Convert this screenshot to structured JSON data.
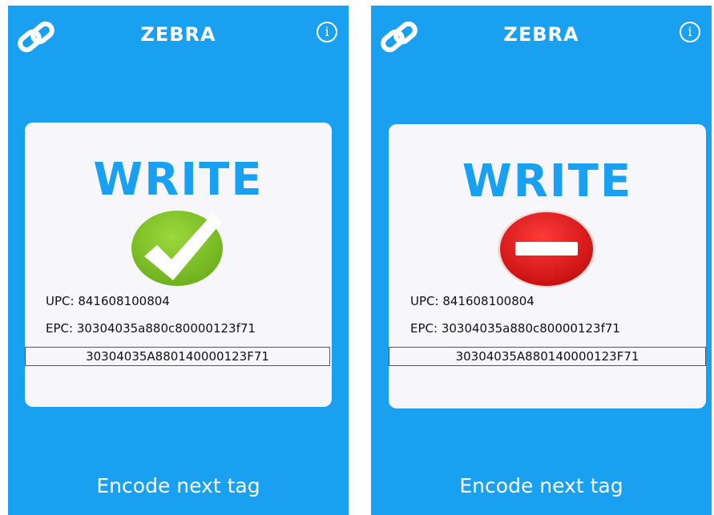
{
  "screens": [
    {
      "app_title": "ZEBRA",
      "info_glyph": "i",
      "heading": "WRITE",
      "status": "success",
      "status_icon": "check-icon",
      "upc_line": "UPC: 841608100804",
      "epc_line": "EPC: 30304035a880c80000123f71",
      "encoded_value": "30304035A880140000123F71",
      "action_label": "Encode next tag"
    },
    {
      "app_title": "ZEBRA",
      "info_glyph": "i",
      "heading": "WRITE",
      "status": "error",
      "status_icon": "stop-icon",
      "upc_line": "UPC: 841608100804",
      "epc_line": "EPC: 30304035a880c80000123f71",
      "encoded_value": "30304035A880140000123F71",
      "action_label": "Encode next tag"
    }
  ],
  "colors": {
    "background": "#1aa0f0",
    "card": "#f6f6fb",
    "heading": "#1aa0f0",
    "success": "#7ac128",
    "error": "#e01515"
  }
}
